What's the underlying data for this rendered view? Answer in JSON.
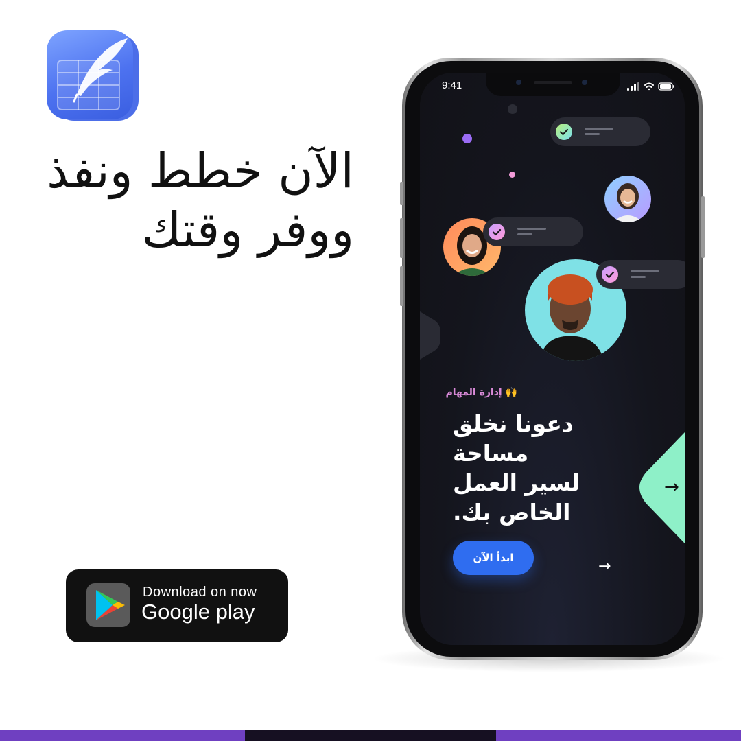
{
  "headline": {
    "line1": "الآن خطط ونفذ",
    "line2": "ووفر وقتك"
  },
  "badge": {
    "line1": "Download on now",
    "line2": "Google play"
  },
  "phone": {
    "status_time": "9:41",
    "tag": "إدارة المهام",
    "tag_emoji": "🙌",
    "title_lines": [
      "دعونا نخلق",
      "مساحة",
      "لسير العمل",
      "الخاص بك."
    ],
    "cta_label": "ابدأ الآن",
    "next_arrow": "→",
    "mint_arrow": "→"
  },
  "colors": {
    "accent_blue": "#2f6df0",
    "tag_pink": "#d98ad8",
    "mint": "#8ef0c8",
    "stripe_purple": "#6f40c1",
    "stripe_dark": "#161022"
  },
  "icons": [
    "app-icon",
    "google-play-icon",
    "check-icon",
    "signal-icon",
    "wifi-icon",
    "battery-icon",
    "arrow-right-icon"
  ]
}
